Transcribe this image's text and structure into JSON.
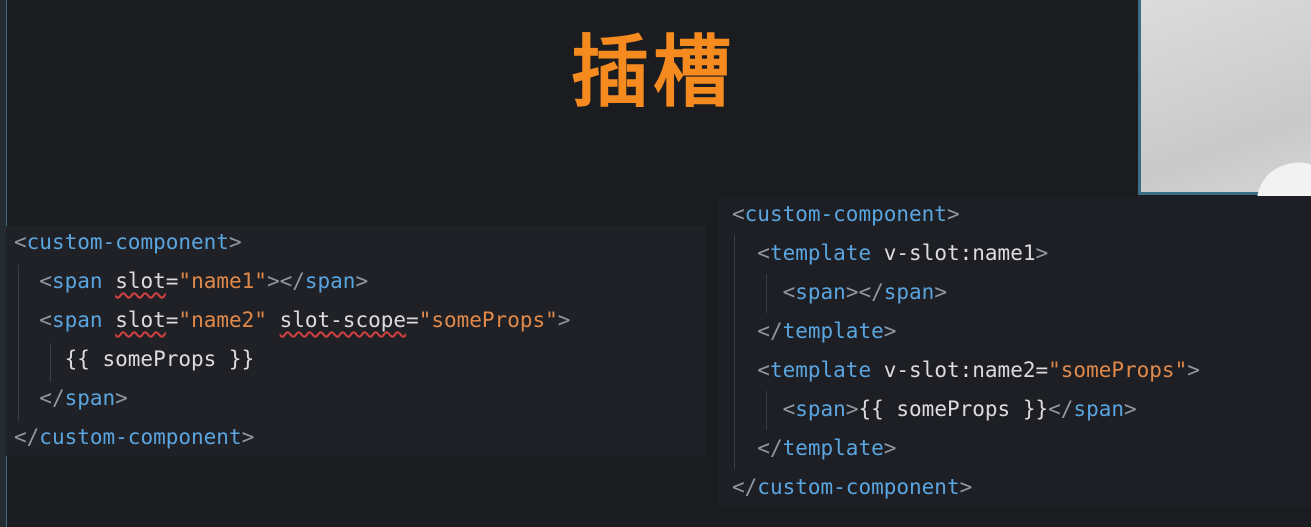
{
  "title": "插槽",
  "left_code": {
    "lines": [
      [
        {
          "c": "p",
          "t": "<"
        },
        {
          "c": "t",
          "t": "custom-component"
        },
        {
          "c": "p",
          "t": ">"
        }
      ],
      [
        {
          "c": "x",
          "t": "  "
        },
        {
          "c": "p",
          "t": "<"
        },
        {
          "c": "t",
          "t": "span"
        },
        {
          "c": "x",
          "t": " "
        },
        {
          "c": "a sq",
          "t": "slot"
        },
        {
          "c": "a",
          "t": "="
        },
        {
          "c": "s",
          "t": "\"name1\""
        },
        {
          "c": "p",
          "t": "></"
        },
        {
          "c": "t",
          "t": "span"
        },
        {
          "c": "p",
          "t": ">"
        }
      ],
      [
        {
          "c": "x",
          "t": "  "
        },
        {
          "c": "p",
          "t": "<"
        },
        {
          "c": "t",
          "t": "span"
        },
        {
          "c": "x",
          "t": " "
        },
        {
          "c": "a sq",
          "t": "slot"
        },
        {
          "c": "a",
          "t": "="
        },
        {
          "c": "s",
          "t": "\"name2\""
        },
        {
          "c": "x",
          "t": " "
        },
        {
          "c": "a sq",
          "t": "slot-scope"
        },
        {
          "c": "a",
          "t": "="
        },
        {
          "c": "s",
          "t": "\"someProps\""
        },
        {
          "c": "p",
          "t": ">"
        }
      ],
      [
        {
          "c": "x",
          "t": "    {{ someProps }}"
        }
      ],
      [
        {
          "c": "x",
          "t": "  "
        },
        {
          "c": "p",
          "t": "</"
        },
        {
          "c": "t",
          "t": "span"
        },
        {
          "c": "p",
          "t": ">"
        }
      ],
      [
        {
          "c": "p",
          "t": "</"
        },
        {
          "c": "t",
          "t": "custom-component"
        },
        {
          "c": "p",
          "t": ">"
        }
      ]
    ]
  },
  "right_code": {
    "lines": [
      [
        {
          "c": "p",
          "t": "<"
        },
        {
          "c": "t",
          "t": "custom-component"
        },
        {
          "c": "p",
          "t": ">"
        }
      ],
      [
        {
          "c": "x",
          "t": "  "
        },
        {
          "c": "p",
          "t": "<"
        },
        {
          "c": "t",
          "t": "template"
        },
        {
          "c": "x",
          "t": " "
        },
        {
          "c": "a",
          "t": "v-slot:name1"
        },
        {
          "c": "p",
          "t": ">"
        }
      ],
      [
        {
          "c": "x",
          "t": "    "
        },
        {
          "c": "p",
          "t": "<"
        },
        {
          "c": "t",
          "t": "span"
        },
        {
          "c": "p",
          "t": "></"
        },
        {
          "c": "t",
          "t": "span"
        },
        {
          "c": "p",
          "t": ">"
        }
      ],
      [
        {
          "c": "x",
          "t": "  "
        },
        {
          "c": "p",
          "t": "</"
        },
        {
          "c": "t",
          "t": "template"
        },
        {
          "c": "p",
          "t": ">"
        }
      ],
      [
        {
          "c": "x",
          "t": "  "
        },
        {
          "c": "p",
          "t": "<"
        },
        {
          "c": "t",
          "t": "template"
        },
        {
          "c": "x",
          "t": " "
        },
        {
          "c": "a",
          "t": "v-slot:name2"
        },
        {
          "c": "a",
          "t": "="
        },
        {
          "c": "s",
          "t": "\"someProps\""
        },
        {
          "c": "p",
          "t": ">"
        }
      ],
      [
        {
          "c": "x",
          "t": "    "
        },
        {
          "c": "p",
          "t": "<"
        },
        {
          "c": "t",
          "t": "span"
        },
        {
          "c": "p",
          "t": ">"
        },
        {
          "c": "x",
          "t": "{{ someProps }}"
        },
        {
          "c": "p",
          "t": "</"
        },
        {
          "c": "t",
          "t": "span"
        },
        {
          "c": "p",
          "t": ">"
        }
      ],
      [
        {
          "c": "x",
          "t": "  "
        },
        {
          "c": "p",
          "t": "</"
        },
        {
          "c": "t",
          "t": "template"
        },
        {
          "c": "p",
          "t": ">"
        }
      ],
      [
        {
          "c": "p",
          "t": "</"
        },
        {
          "c": "t",
          "t": "custom-component"
        },
        {
          "c": "p",
          "t": ">"
        }
      ]
    ]
  }
}
